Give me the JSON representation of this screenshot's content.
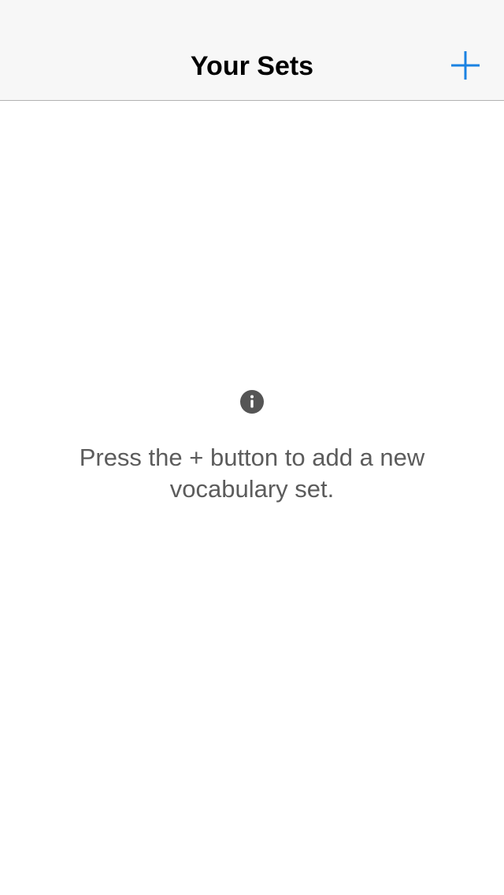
{
  "navbar": {
    "title": "Your Sets",
    "add_icon": "plus-icon",
    "accent_color": "#1a82e2"
  },
  "empty_state": {
    "icon": "info-icon",
    "icon_color": "#555555",
    "message": "Press the + button to add a new vocabulary set."
  }
}
